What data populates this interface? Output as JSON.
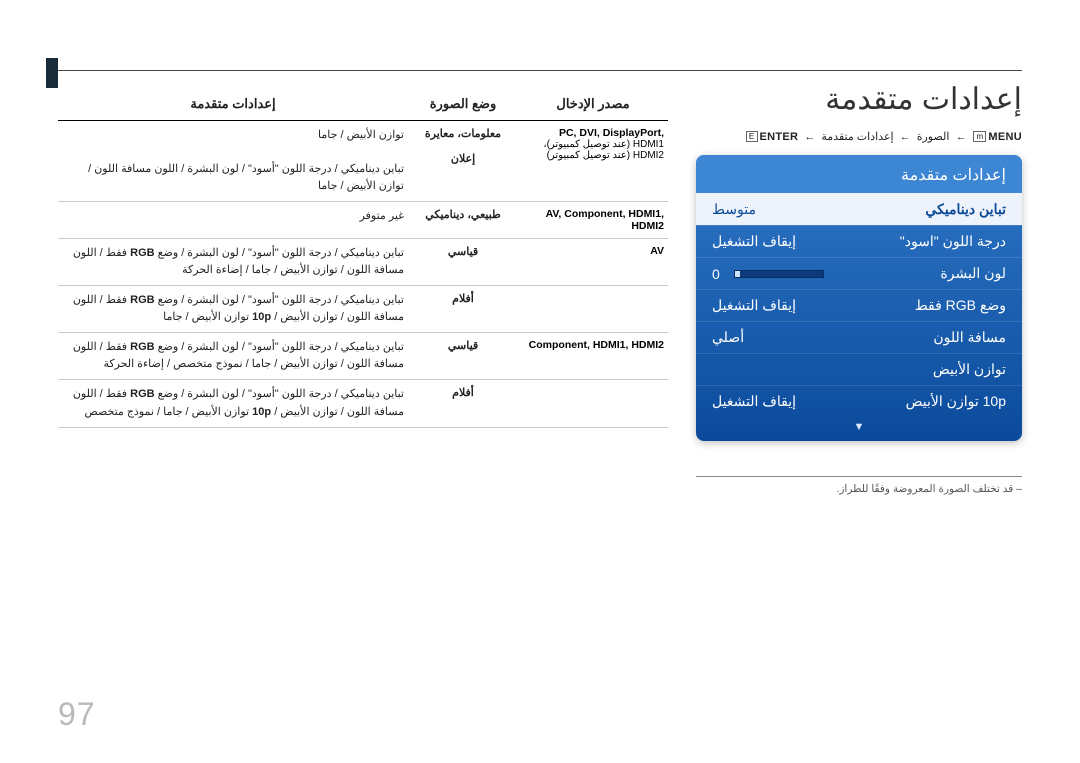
{
  "page_number": "97",
  "main_title": "إعدادات متقدمة",
  "breadcrumb": {
    "menu_kw": "MENU",
    "menu_box": "m",
    "picture": "الصورة",
    "advanced": "إعدادات متقدمة",
    "enter_kw": "ENTER",
    "enter_box": "E"
  },
  "osd": {
    "title": "إعدادات متقدمة",
    "rows": [
      {
        "label": "تباين ديناميكي",
        "value": "متوسط",
        "hi": true
      },
      {
        "label": "درجة اللون \"اسود\"",
        "value": "إيقاف التشغيل"
      },
      {
        "label": "لون البشرة",
        "value": "0",
        "slider": true
      },
      {
        "label": "وضع RGB فقط",
        "value": "إيقاف التشغيل"
      },
      {
        "label": "مسافة اللون",
        "value": "أصلي"
      },
      {
        "label": "توازن الأبيض",
        "value": ""
      },
      {
        "label": "10p توازن الأبيض",
        "value": "إيقاف التشغيل"
      }
    ]
  },
  "osd_note": "– قد تختلف الصورة المعروضة وفقًا للطراز.",
  "table": {
    "headers": {
      "source": "مصدر الإدخال",
      "mode": "وضع الصورة",
      "options": "إعدادات متقدمة"
    },
    "rows": [
      {
        "source_main": "PC, DVI, DisplayPort,",
        "source_sub": "HDMI1 (عند توصيل كمبيوتر)،\nHDMI2 (عند توصيل كمبيوتر)",
        "mode": "معلومات، معايرة\n\nإعلان",
        "options": "توازن الأبيض / جاما\n\nتباين ديناميكي / درجة اللون \"أسود\" / لون البشرة / اللون مسافة اللون / توازن الأبيض / جاما"
      },
      {
        "source_main": "AV, Component, HDMI1, HDMI2",
        "source_sub": "",
        "mode": "طبيعي، ديناميكي",
        "options": "غير متوفر"
      },
      {
        "source_main": "AV",
        "source_sub": "",
        "mode": "قياسي",
        "options": "تباين ديناميكي / درجة اللون \"أسود\" / لون البشرة / وضع RGB فقط / اللون مسافة اللون / توازن الأبيض / جاما / إضاءة الحركة"
      },
      {
        "source_main": "",
        "source_sub": "",
        "mode": "أفلام",
        "options": "تباين ديناميكي / درجة اللون \"أسود\" / لون البشرة / وضع RGB فقط / اللون مسافة اللون / توازن الأبيض / 10p توازن الأبيض / جاما"
      },
      {
        "source_main": "Component, HDMI1, HDMI2",
        "source_sub": "",
        "mode": "قياسي",
        "options": "تباين ديناميكي / درجة اللون \"أسود\" / لون البشرة / وضع RGB فقط / اللون مسافة اللون / توازن الأبيض / جاما / نموذج متخصص / إضاءة الحركة"
      },
      {
        "source_main": "",
        "source_sub": "",
        "mode": "أفلام",
        "options": "تباين ديناميكي / درجة اللون \"أسود\" / لون البشرة / وضع RGB فقط / اللون مسافة اللون / توازن الأبيض / 10p توازن الأبيض / جاما / نموذج متخصص"
      }
    ]
  }
}
